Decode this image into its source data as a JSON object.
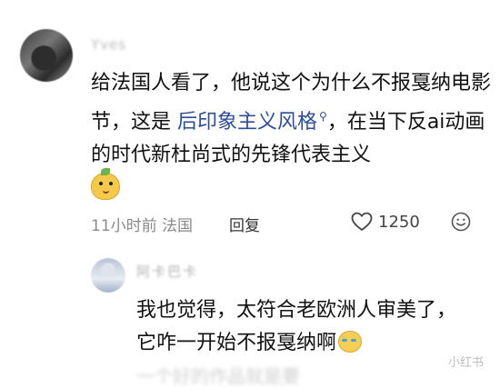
{
  "comment": {
    "username": "Yves",
    "text_part1": "给法国人看了，他说这个为什么不报戛纳电影节，这是 ",
    "link_text": "后印象主义风格",
    "text_part2": "，在当下反ai动画的时代新杜尚式的先锋代表主义",
    "time": "11小时前",
    "location": "法国",
    "reply_label": "回复",
    "like_count": "1250"
  },
  "reply": {
    "username": "阿卡巴卡",
    "text_line1": "我也觉得，太符合老欧洲人审美了，",
    "text_line2": "它咋一开始不报戛纳啊"
  },
  "next_comment_preview": "一个好的作品就是要",
  "watermark": "小红书"
}
